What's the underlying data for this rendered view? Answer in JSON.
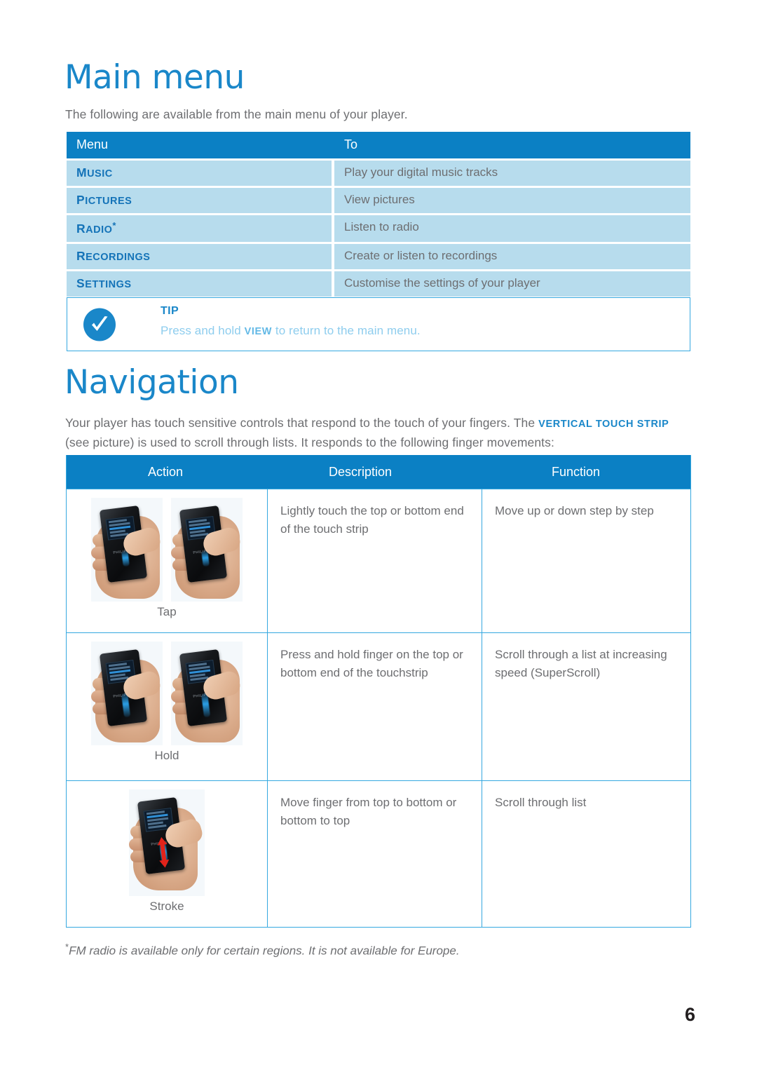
{
  "main_menu": {
    "title": "Main menu",
    "intro": "The following are available from the main menu of your player.",
    "table": {
      "headers": [
        "Menu",
        "To"
      ],
      "rows": [
        {
          "menu": "Music",
          "to": "Play your digital music tracks"
        },
        {
          "menu": "Pictures",
          "to": "View pictures"
        },
        {
          "menu": "Radio*",
          "to": "Listen to radio"
        },
        {
          "menu": "Recordings",
          "to": "Create or listen to recordings"
        },
        {
          "menu": "Settings",
          "to": "Customise the settings of your player"
        }
      ]
    }
  },
  "tip": {
    "icon": "check-circle-icon",
    "label": "TIP",
    "text_before": "Press and hold ",
    "keyword": "VIEW",
    "text_after": " to return to the main menu."
  },
  "navigation": {
    "title": "Navigation",
    "intro_before": "Your player has touch sensitive controls that respond to the touch of your fingers. The ",
    "intro_keyword": "VERTICAL TOUCH STRIP",
    "intro_after": " (see picture) is used to scroll through lists. It responds to the following finger movements:",
    "table": {
      "headers": [
        "Action",
        "Description",
        "Function"
      ],
      "rows": [
        {
          "caption": "Tap",
          "images": 2,
          "description": "Lightly touch the top or bottom end of the touch strip",
          "function": "Move up or down step by step"
        },
        {
          "caption": "Hold",
          "images": 2,
          "description": "Press and hold finger on the top or bottom end of the touchstrip",
          "function": "Scroll through a list at increasing speed (SuperScroll)"
        },
        {
          "caption": "Stroke",
          "images": 1,
          "description": "Move finger from top to bottom or bottom to top",
          "function": "Scroll through list"
        }
      ]
    }
  },
  "footnote": {
    "marker": "*",
    "text": "FM radio is available only for certain regions. It is not available for Europe."
  },
  "page_number": "6",
  "colors": {
    "heading_blue": "#1a87c9",
    "table_header_blue": "#0b80c4",
    "row_blue": "#b7dced",
    "border_blue": "#35a8e0",
    "body_gray": "#6d6e71",
    "tip_text_blue": "#8ecdee",
    "arrow_red": "#e2231a"
  }
}
